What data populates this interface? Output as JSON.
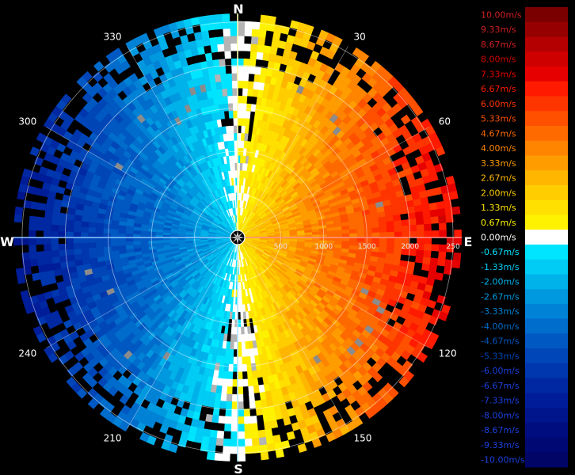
{
  "chart_data": {
    "type": "heatmap",
    "subtype": "radar-velocity-ppi",
    "cardinals": {
      "north": "N",
      "east": "E",
      "south": "S",
      "west": "W"
    },
    "azimuth_labels": [
      {
        "az": 30,
        "text": "30"
      },
      {
        "az": 60,
        "text": "60"
      },
      {
        "az": 120,
        "text": "120"
      },
      {
        "az": 150,
        "text": "150"
      },
      {
        "az": 210,
        "text": "210"
      },
      {
        "az": 240,
        "text": "240"
      },
      {
        "az": 300,
        "text": "300"
      },
      {
        "az": 330,
        "text": "330"
      }
    ],
    "range_rings": [
      500,
      1000,
      1500,
      2000,
      2500
    ],
    "range_labels": [
      {
        "value": 500,
        "text": "500"
      },
      {
        "value": 1000,
        "text": "1000"
      },
      {
        "value": 1500,
        "text": "1500"
      },
      {
        "value": 2000,
        "text": "2000"
      },
      {
        "value": 2500,
        "text": "250"
      }
    ],
    "max_range": 2600,
    "pattern": {
      "positive_sector_deg": [
        0,
        180
      ],
      "negative_sector_deg": [
        180,
        360
      ],
      "peak_positive_azimuth": 90,
      "peak_negative_azimuth": 270,
      "peak_positive_value": 7.33,
      "peak_negative_value": -7.33
    },
    "legend": {
      "title": "",
      "entries": [
        {
          "label": "10.00m/s",
          "value": 10.0,
          "color": "#7a0000"
        },
        {
          "label": "9.33m/s",
          "value": 9.33,
          "color": "#960000"
        },
        {
          "label": "8.67m/s",
          "value": 8.67,
          "color": "#b40000"
        },
        {
          "label": "8.00m/s",
          "value": 8.0,
          "color": "#cf0000"
        },
        {
          "label": "7.33m/s",
          "value": 7.33,
          "color": "#e60000"
        },
        {
          "label": "6.67m/s",
          "value": 6.67,
          "color": "#ff1a00"
        },
        {
          "label": "6.00m/s",
          "value": 6.0,
          "color": "#ff3500"
        },
        {
          "label": "5.33m/s",
          "value": 5.33,
          "color": "#ff5000"
        },
        {
          "label": "4.67m/s",
          "value": 4.67,
          "color": "#ff6a00"
        },
        {
          "label": "4.00m/s",
          "value": 4.0,
          "color": "#ff8400"
        },
        {
          "label": "3.33m/s",
          "value": 3.33,
          "color": "#ff9d00"
        },
        {
          "label": "2.67m/s",
          "value": 2.67,
          "color": "#ffb600"
        },
        {
          "label": "2.00m/s",
          "value": 2.0,
          "color": "#ffcd00"
        },
        {
          "label": "1.33m/s",
          "value": 1.33,
          "color": "#ffe000"
        },
        {
          "label": "0.67m/s",
          "value": 0.67,
          "color": "#fff200"
        },
        {
          "label": "0.00m/s",
          "value": 0.0,
          "color": "#ffffff"
        },
        {
          "label": "-0.67m/s",
          "value": -0.67,
          "color": "#00e5ff"
        },
        {
          "label": "-1.33m/s",
          "value": -1.33,
          "color": "#00ccf5"
        },
        {
          "label": "-2.00m/s",
          "value": -2.0,
          "color": "#00b2ea"
        },
        {
          "label": "-2.67m/s",
          "value": -2.67,
          "color": "#0099e0"
        },
        {
          "label": "-3.33m/s",
          "value": -3.33,
          "color": "#0082d6"
        },
        {
          "label": "-4.00m/s",
          "value": -4.0,
          "color": "#006ccc"
        },
        {
          "label": "-4.67m/s",
          "value": -4.67,
          "color": "#0058c2"
        },
        {
          "label": "-5.33m/s",
          "value": -5.33,
          "color": "#0046b8"
        },
        {
          "label": "-6.00m/s",
          "value": -6.0,
          "color": "#0036ae"
        },
        {
          "label": "-6.67m/s",
          "value": -6.67,
          "color": "#0028a3"
        },
        {
          "label": "-7.33m/s",
          "value": -7.33,
          "color": "#001d99"
        },
        {
          "label": "-8.00m/s",
          "value": -8.0,
          "color": "#00148c"
        },
        {
          "label": "-8.67m/s",
          "value": -8.67,
          "color": "#000d7f"
        },
        {
          "label": "-9.33m/s",
          "value": -9.33,
          "color": "#000873"
        },
        {
          "label": "-10.00m/s",
          "value": -10.0,
          "color": "#000566"
        }
      ]
    }
  }
}
